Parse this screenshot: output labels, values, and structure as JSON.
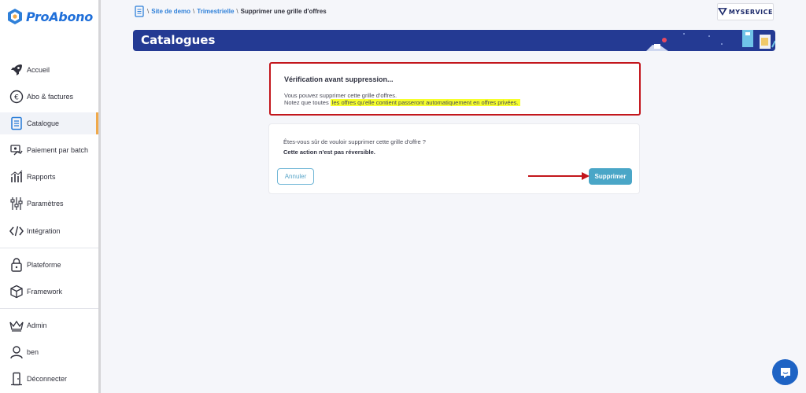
{
  "app": {
    "logo_text": "ProAbono"
  },
  "sidebar": {
    "items": [
      {
        "label": "Accueil",
        "icon": "rocket-icon"
      },
      {
        "label": "Abo & factures",
        "icon": "euro-icon"
      },
      {
        "label": "Catalogue",
        "icon": "catalog-icon",
        "active": true
      },
      {
        "label": "Paiement par batch",
        "icon": "batch-payment-icon"
      },
      {
        "label": "Rapports",
        "icon": "reports-icon"
      },
      {
        "label": "Paramètres",
        "icon": "sliders-icon"
      },
      {
        "label": "Intégration",
        "icon": "code-icon"
      },
      {
        "label": "Plateforme",
        "icon": "lock-icon"
      },
      {
        "label": "Framework",
        "icon": "cube-icon"
      },
      {
        "label": "Admin",
        "icon": "crown-icon"
      },
      {
        "label": "ben",
        "icon": "user-icon"
      },
      {
        "label": "Déconnecter",
        "icon": "logout-icon"
      }
    ]
  },
  "breadcrumb": {
    "items": [
      "Site de demo",
      "Trimestrielle"
    ],
    "current": "Supprimer une grille d'offres",
    "separator": "\\"
  },
  "brand": {
    "name": "MYSERVICE"
  },
  "banner": {
    "title": "Catalogues"
  },
  "warning": {
    "title": "Vérification avant suppression...",
    "line1": "Vous pouvez supprimer cette grille d'offres.",
    "line2_prefix": "Notez que toutes ",
    "line2_highlight": "les offres qu'elle contient passeront automatiquement en offres privées.",
    "border_color": "#c3161c",
    "highlight_color": "#f6ff2c"
  },
  "confirm": {
    "question": "Êtes-vous sûr de vouloir supprimer cette grille d'offre ?",
    "note": "Cette action n'est pas réversible.",
    "cancel_label": "Annuler",
    "delete_label": "Supprimer"
  },
  "colors": {
    "accent": "#243a93",
    "link": "#2f80d9",
    "button": "#4aa6c7",
    "annotation": "#c3161c"
  }
}
